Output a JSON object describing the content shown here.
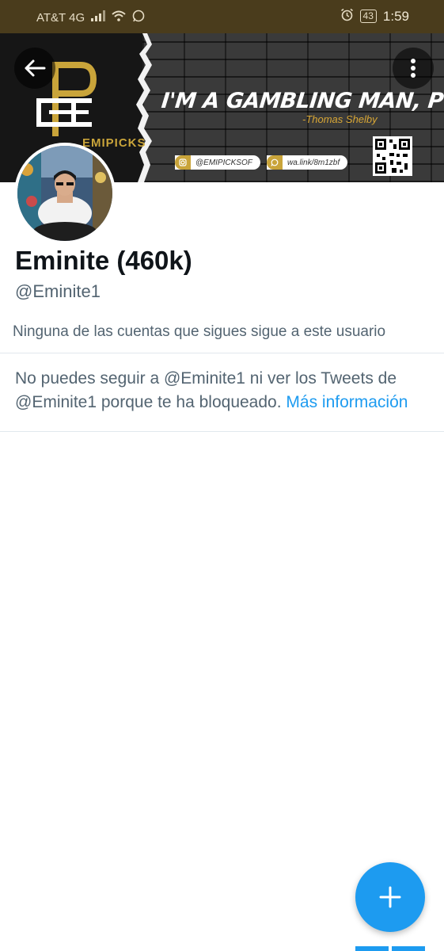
{
  "status_bar": {
    "carrier": "AT&T 4G",
    "battery": "43",
    "time": "1:59"
  },
  "banner": {
    "brand": "EMIPICKS",
    "quote": "I'M A GAMBLING MAN, POL.",
    "quote_author": "-Thomas Shelby",
    "instagram": "@EMIPICKSOF",
    "whatsapp": "wa.link/8m1zbf"
  },
  "profile": {
    "display_name": "Eminite (460k)",
    "handle": "@Eminite1",
    "followers_note": "Ninguna de las cuentas que sigues sigue a este usuario",
    "blocked_message": "No puedes seguir a @Eminite1 ni ver los Tweets de @Eminite1 porque te ha bloqueado.",
    "more_info_link": "Más información"
  },
  "colors": {
    "status_bar": "#4a3c1c",
    "accent": "#1d9bf0",
    "gold": "#c9a43a",
    "text_primary": "#0f1419",
    "text_secondary": "#536471"
  },
  "icons": {
    "back": "arrow-left-icon",
    "more": "more-vertical-icon",
    "compose": "plus-icon"
  }
}
